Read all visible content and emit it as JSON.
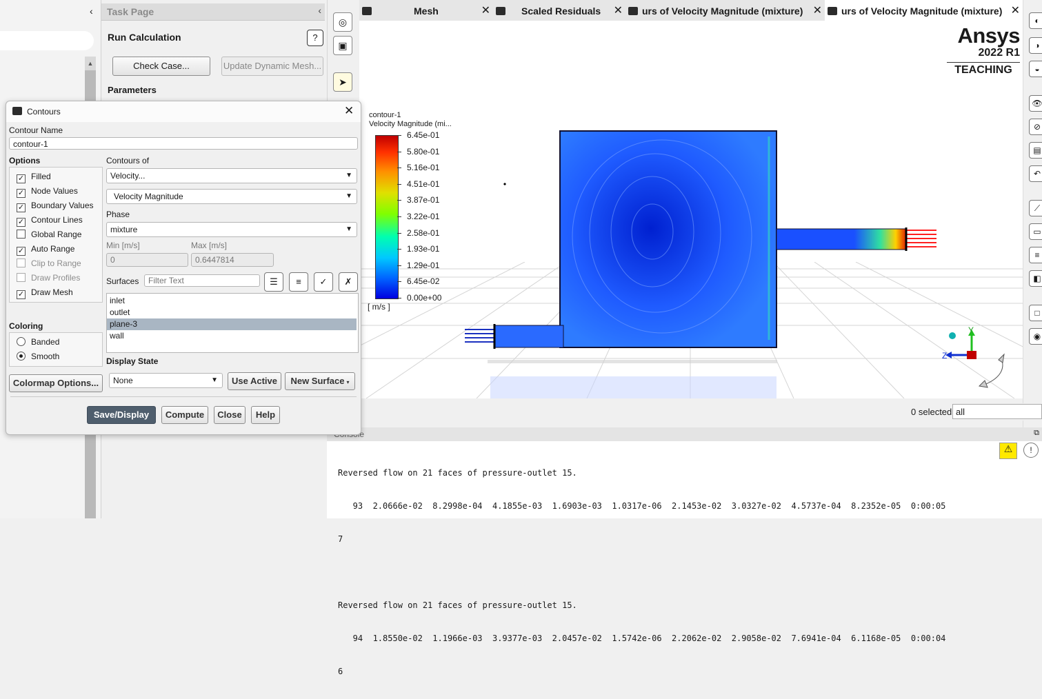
{
  "task_page": {
    "title": "Task Page",
    "section": "Run Calculation",
    "help_glyph": "?",
    "check_case": "Check Case...",
    "update_dynamic_mesh": "Update Dynamic Mesh...",
    "parameters": "Parameters"
  },
  "tabs": [
    {
      "label": "Mesh"
    },
    {
      "label": "Scaled Residuals"
    },
    {
      "label": "urs of Velocity Magnitude (mixture)"
    },
    {
      "label": "urs of Velocity Magnitude (mixture)"
    }
  ],
  "brand": {
    "name": "Ansys",
    "version": "2022 R1",
    "edition": "TEACHING"
  },
  "legend": {
    "title": "contour-1",
    "subtitle": "Velocity Magnitude (mi...",
    "units": "[ m/s ]",
    "labels": [
      "6.45e-01",
      "5.80e-01",
      "5.16e-01",
      "4.51e-01",
      "3.87e-01",
      "3.22e-01",
      "2.58e-01",
      "1.93e-01",
      "1.29e-01",
      "6.45e-02",
      "0.00e+00"
    ]
  },
  "triad": {
    "y": "Y",
    "z": "Z"
  },
  "selection": {
    "count_text": "0 selected",
    "filter_value": "all"
  },
  "console": {
    "title": "Console",
    "lines": [
      "Reversed flow on 21 faces of pressure-outlet 15.",
      "   93  2.0666e-02  8.2998e-04  4.1855e-03  1.6903e-03  1.0317e-06  2.1453e-02  3.0327e-02  4.5737e-04  8.2352e-05  0:00:05",
      "7",
      "",
      "Reversed flow on 21 faces of pressure-outlet 15.",
      "   94  1.8550e-02  1.1966e-03  3.9377e-03  2.0457e-02  1.5742e-06  2.2062e-02  2.9058e-02  7.6941e-04  6.1168e-05  0:00:04",
      "6"
    ]
  },
  "dialog": {
    "title": "Contours",
    "contour_name_label": "Contour Name",
    "contour_name_value": "contour-1",
    "options_label": "Options",
    "options": [
      {
        "label": "Filled",
        "checked": true,
        "enabled": true
      },
      {
        "label": "Node Values",
        "checked": true,
        "enabled": true
      },
      {
        "label": "Boundary Values",
        "checked": true,
        "enabled": true
      },
      {
        "label": "Contour Lines",
        "checked": true,
        "enabled": true
      },
      {
        "label": "Global Range",
        "checked": false,
        "enabled": true
      },
      {
        "label": "Auto Range",
        "checked": true,
        "enabled": true
      },
      {
        "label": "Clip to Range",
        "checked": false,
        "enabled": false
      },
      {
        "label": "Draw Profiles",
        "checked": false,
        "enabled": false
      },
      {
        "label": "Draw Mesh",
        "checked": true,
        "enabled": true
      }
    ],
    "coloring_label": "Coloring",
    "coloring": [
      {
        "label": "Banded",
        "selected": false
      },
      {
        "label": "Smooth",
        "selected": true
      }
    ],
    "colormap_button": "Colormap Options...",
    "contours_of_label": "Contours of",
    "contours_of_value": "Velocity...",
    "contours_of_sub_value": "Velocity Magnitude",
    "phase_label": "Phase",
    "phase_value": "mixture",
    "min_label": "Min [m/s]",
    "min_value": "0",
    "max_label": "Max [m/s]",
    "max_value": "0.6447814",
    "surfaces_label": "Surfaces",
    "surfaces_filter_placeholder": "Filter Text",
    "surfaces": [
      {
        "label": "inlet",
        "selected": false
      },
      {
        "label": "outlet",
        "selected": false
      },
      {
        "label": "plane-3",
        "selected": true
      },
      {
        "label": "wall",
        "selected": false
      }
    ],
    "display_state_label": "Display State",
    "display_state_value": "None",
    "use_active": "Use Active",
    "new_surface": "New Surface",
    "buttons": {
      "save_display": "Save/Display",
      "compute": "Compute",
      "close": "Close",
      "help": "Help"
    }
  },
  "colors": {
    "accent": "#4f5e6d",
    "domain_blue": "#1f5bff",
    "selected_row": "#a9b6c3"
  }
}
